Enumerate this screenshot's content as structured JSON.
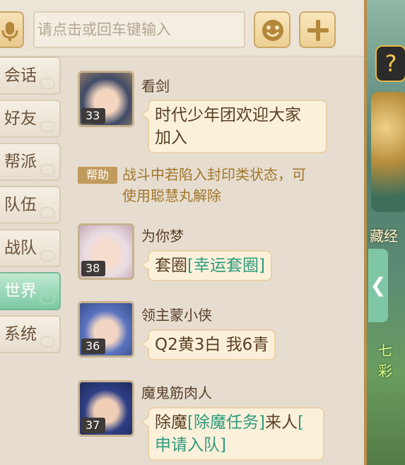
{
  "input": {
    "placeholder": "请点击或回车键输入"
  },
  "tabs": [
    {
      "label": "会话",
      "active": false
    },
    {
      "label": "好友",
      "active": false
    },
    {
      "label": "帮派",
      "active": false
    },
    {
      "label": "队伍",
      "active": false
    },
    {
      "label": "战队",
      "active": false
    },
    {
      "label": "世界",
      "active": true
    },
    {
      "label": "系统",
      "active": false
    }
  ],
  "messages": [
    {
      "name": "看剑",
      "level": "33",
      "text": "时代少年团欢迎大家加入",
      "line1": "时代少年团欢迎大家",
      "line2": "加入"
    },
    {
      "name": "为你梦",
      "level": "38",
      "prefix": "套圈",
      "link": "[幸运套圈]"
    },
    {
      "name": "领主蒙小侠",
      "level": "36",
      "text": "Q2黄3白 我6青"
    },
    {
      "name": "魔鬼筋肉人",
      "level": "37",
      "prefix": "除魔",
      "link": "[除魔任务]",
      "suffix": "来人",
      "link2a": "[",
      "link2b": "申请入队]"
    }
  ],
  "help": {
    "badge": "帮助",
    "line1": "战斗中若陷入封印类状态，可",
    "line2": "使用聪慧丸解除"
  },
  "scene": {
    "label_top": "藏经阁",
    "label_bottom": "七彩"
  },
  "colors": {
    "link": "#2e9a7c",
    "active_tab": "#7cc9a3",
    "help_text": "#a2762a"
  }
}
